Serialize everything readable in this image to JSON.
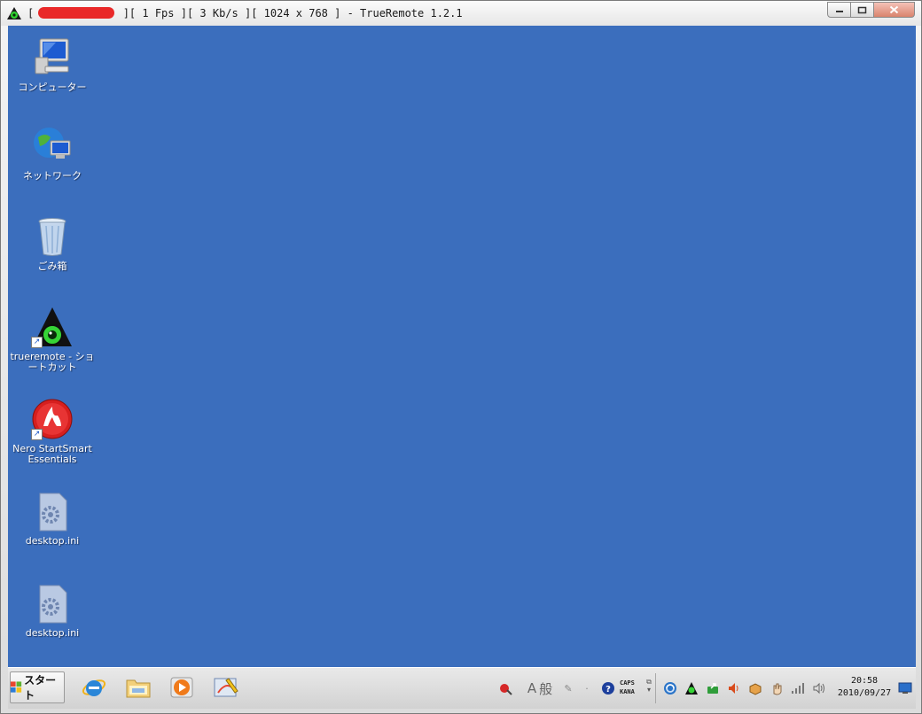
{
  "window": {
    "title_prefix": "[",
    "title_stats": "][ 1 Fps ][ 3 Kb/s ][ 1024 x 768 ] - TrueRemote 1.2.1",
    "app_icon": "trueremote-eye-icon",
    "controls": {
      "minimize": "minimize-icon",
      "maximize": "maximize-icon",
      "close": "close-icon"
    }
  },
  "desktop": {
    "background_color": "#3b6ebd",
    "icons": [
      {
        "label": "コンピューター",
        "icon": "computer-icon"
      },
      {
        "label": "ネットワーク",
        "icon": "network-icon"
      },
      {
        "label": "ごみ箱",
        "icon": "recycle-bin-icon"
      },
      {
        "label": "trueremote - ショートカット",
        "icon": "trueremote-shortcut-icon"
      },
      {
        "label": "Nero StartSmart Essentials",
        "icon": "nero-icon"
      },
      {
        "label": "desktop.ini",
        "icon": "settings-file-icon"
      },
      {
        "label": "desktop.ini",
        "icon": "settings-file-icon"
      }
    ]
  },
  "taskbar": {
    "start_label": "スタート",
    "quick_launch": [
      "internet-explorer-icon",
      "explorer-folder-icon",
      "media-player-icon",
      "paint-icon"
    ],
    "ime": {
      "a": "A",
      "mode": "般"
    },
    "caps": "CAPS",
    "kana": "KANA",
    "clock_time": "20:58",
    "clock_date": "2010/09/27"
  }
}
